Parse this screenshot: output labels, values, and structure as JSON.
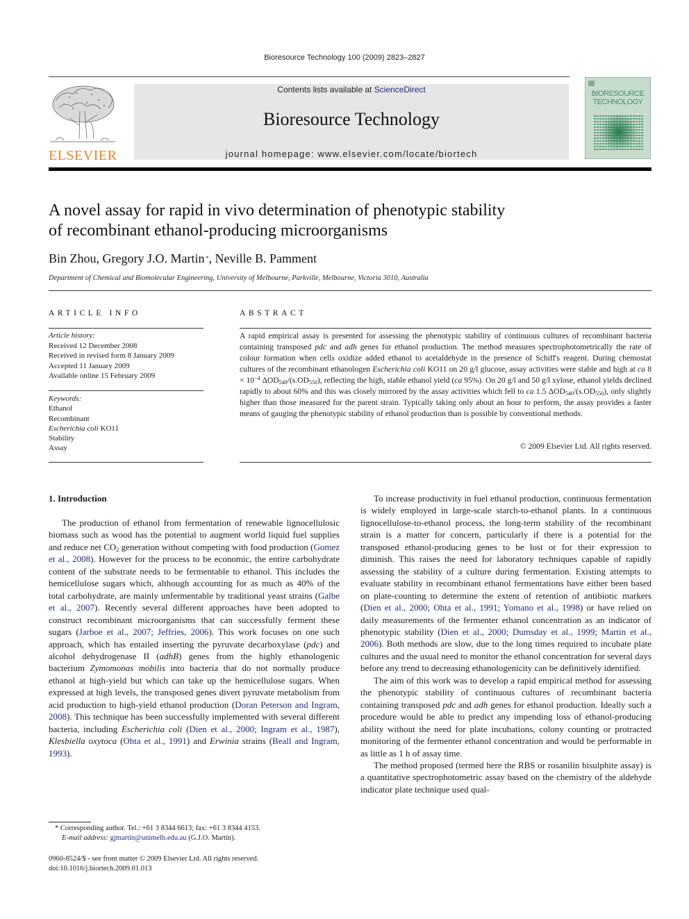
{
  "running_header": "Bioresource Technology 100 (2009) 2823–2827",
  "masthead": {
    "publisher_wordmark": "ELSEVIER",
    "publisher_logo_icon": "elsevier-tree-icon",
    "contents_prefix": "Contents lists available at ",
    "contents_link": "ScienceDirect",
    "journal_title": "Bioresource Technology",
    "homepage_label": "journal homepage: www.elsevier.com/locate/biortech",
    "cover": {
      "line1": "BIORESOURCE",
      "line2": "TECHNOLOGY",
      "accent_color": "#4d8d6a"
    },
    "wordmark_color": "#f0821e",
    "banner_color": "#e6e6e6"
  },
  "article": {
    "title_line1": "A novel assay for rapid in vivo determination of phenotypic stability",
    "title_line2": "of recombinant ethanol-producing microorganisms",
    "authors": [
      {
        "name": "Bin Zhou",
        "sep": ", "
      },
      {
        "name": "Gregory J.O. Martin",
        "mark": " *",
        "sep": ", "
      },
      {
        "name": "Neville B. Pamment",
        "sep": ""
      }
    ],
    "affiliation": "Department of Chemical and Biomolecular Engineering, University of Melbourne, Parkville, Melbourne, Victoria 3010, Australia"
  },
  "article_info": {
    "heading": "ARTICLE INFO",
    "history_label": "Article history:",
    "history": [
      "Received 12 December 2008",
      "Received in revised form 8 January 2009",
      "Accepted 11 January 2009",
      "Available online 15 February 2009"
    ],
    "keywords_label": "Keywords:",
    "keywords": [
      {
        "text": "Ethanol"
      },
      {
        "text": "Recombinant"
      },
      {
        "italic": "Escherichia coli",
        "text": " KO11"
      },
      {
        "text": "Stability"
      },
      {
        "text": "Assay"
      }
    ]
  },
  "abstract": {
    "heading": "ABSTRACT",
    "segments": [
      {
        "t": "A rapid empirical assay is presented for assessing the phenotypic stability of continuous cultures of recombinant bacteria containing transposed "
      },
      {
        "i": "pdc"
      },
      {
        "t": " and "
      },
      {
        "i": "adh"
      },
      {
        "t": " genes for ethanol production. The method measures spectrophotometrically the rate of colour formation when cells oxidize added ethanol to acetaldehyde in the presence of Schiff's reagent. During chemostat cultures of the recombinant ethanologen "
      },
      {
        "i": "Escherichia coli"
      },
      {
        "t": " KO11 on 20 g/l glucose, assay activities were stable and high at "
      },
      {
        "i": "ca"
      },
      {
        "t": " 8 × 10"
      },
      {
        "sup": "−4"
      },
      {
        "t": " ΔOD"
      },
      {
        "sub": "540"
      },
      {
        "t": "/(s.OD"
      },
      {
        "sub": "550"
      },
      {
        "t": "), reflecting the high, stable ethanol yield ("
      },
      {
        "i": "ca"
      },
      {
        "t": " 95%). On 20 g/l and 50 g/l xylose, ethanol yields declined rapidly to about 60% and this was closely mirrored by the assay activities which fell to "
      },
      {
        "i": "ca"
      },
      {
        "t": " 1.5 ΔOD"
      },
      {
        "sub": "540"
      },
      {
        "t": "/(s.OD"
      },
      {
        "sub": "550"
      },
      {
        "t": "), only slightly higher than those measured for the parent strain. Typically taking only about an hour to perform, the assay provides a faster means of gauging the phenotypic stability of ethanol production than is possible by conventional methods."
      }
    ],
    "copyright": "© 2009 Elsevier Ltd. All rights reserved."
  },
  "body": {
    "section_heading": "1. Introduction",
    "left_paragraphs": [
      [
        {
          "t": "The production of ethanol from fermentation of renewable lignocellulosic biomass such as wood has the potential to augment world liquid fuel supplies and reduce net CO"
        },
        {
          "sub": "2"
        },
        {
          "t": " generation without competing with food production ("
        },
        {
          "a": "Gomez et al., 2008"
        },
        {
          "t": "). However for the process to be economic, the entire carbohydrate content of the substrate needs to be fermentable to ethanol. This includes the hemicellulose sugars which, although accounting for as much as 40% of the total carbohydrate, are mainly unfermentable by traditional yeast strains ("
        },
        {
          "a": "Galbe et al., 2007"
        },
        {
          "t": "). Recently several different approaches have been adopted to construct recombinant microorganisms that can successfully ferment these sugars ("
        },
        {
          "a": "Jarboe et al., 2007; Jeffries, 2006"
        },
        {
          "t": "). This work focuses on one such approach, which has entailed inserting the pyruvate decarboxylase ("
        },
        {
          "i": "pdc"
        },
        {
          "t": ") and alcohol dehydrogenase II ("
        },
        {
          "i": "adhB"
        },
        {
          "t": ") genes from the highly ethanologenic bacterium "
        },
        {
          "i": "Zymomonas mobilis"
        },
        {
          "t": " into bacteria that do not normally produce ethanol at high-yield but which can take up the hemicellulose sugars. When expressed at high levels, the transposed genes divert pyruvate metabolism from acid production to high-yield ethanol production ("
        },
        {
          "a": "Doran Peterson and Ingram, 2008"
        },
        {
          "t": "). This technique has been successfully implemented with several different bacteria, including "
        },
        {
          "i": "Escherichia coli"
        },
        {
          "t": " ("
        },
        {
          "a": "Dien et al., 2000; Ingram et al., 1987"
        },
        {
          "t": "), "
        },
        {
          "i": "Klesbiella oxytoca"
        },
        {
          "t": " ("
        },
        {
          "a": "Ohta et al., 1991"
        },
        {
          "t": ") and "
        },
        {
          "i": "Erwinia"
        },
        {
          "t": " strains ("
        },
        {
          "a": "Beall and Ingram, 1993"
        },
        {
          "t": ")."
        }
      ]
    ],
    "right_paragraphs": [
      [
        {
          "t": "To increase productivity in fuel ethanol production, continuous fermentation is widely employed in large-scale starch-to-ethanol plants. In a continuous lignocellulose-to-ethanol process, the long-term stability of the recombinant strain is a matter for concern, particularly if there is a potential for the transposed ethanol-producing genes to be lost or for their expression to diminish. This raises the need for laboratory techniques capable of rapidly assessing the stability of a culture during fermentation. Existing attempts to evaluate stability in recombinant ethanol fermentations have either been based on plate-counting to determine the extent of retention of antibiotic markers ("
        },
        {
          "a": "Dien et al., 2000; Ohta et al., 1991; Yomano et al., 1998"
        },
        {
          "t": ") or have relied on daily measurements of the fermenter ethanol concentration as an indicator of phenotypic stability ("
        },
        {
          "a": "Dien et al., 2000; Dumsday et al., 1999; Martin et al., 2006"
        },
        {
          "t": "). Both methods are slow, due to the long times required to incubate plate cultures and the usual need to monitor the ethanol concentration for several days before any trend to decreasing ethanologenicity can be definitively identified."
        }
      ],
      [
        {
          "t": "The aim of this work was to develop a rapid empirical method for assessing the phenotypic stability of continuous cultures of recombinant bacteria containing transposed "
        },
        {
          "i": "pdc"
        },
        {
          "t": " and "
        },
        {
          "i": "adh"
        },
        {
          "t": " genes for ethanol production. Ideally such a procedure would be able to predict any impending loss of ethanol-producing ability without the need for plate incubations, colony counting or protracted monitoring of the fermenter ethanol concentration and would be performable in as little as 1 h of assay time."
        }
      ],
      [
        {
          "t": "The method proposed (termed here the RBS or rosanilin bisulphite assay) is a quantitative spectrophotometric assay based on the chemistry of the aldehyde indicator plate technique used qual-"
        }
      ]
    ]
  },
  "footnote": {
    "mark": "*",
    "line1": " Corresponding author. Tel.: +61 3 8344 6613; fax: +61 3 8344 4153.",
    "email_label": "E-mail address:",
    "email": "gjmartin@unimelb.edu.au",
    "email_suffix": " (G.J.O. Martin)."
  },
  "front_matter": {
    "issn_line": "0960-8524/$ - see front matter © 2009 Elsevier Ltd. All rights reserved.",
    "doi": "doi:10.1016/j.biortech.2009.01.013"
  },
  "colors": {
    "link": "#1f2a7a",
    "elsevier_orange": "#f0821e",
    "cover_green": "#c6dccd"
  }
}
